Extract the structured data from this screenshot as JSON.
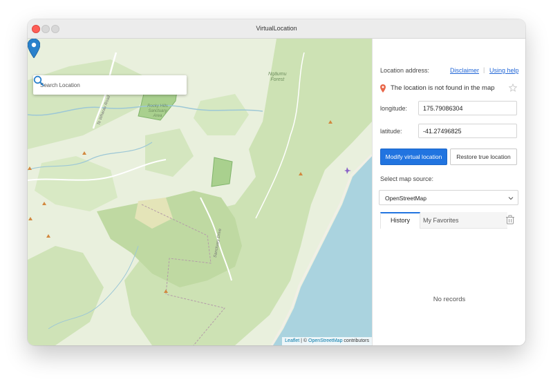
{
  "window": {
    "title": "VirtualLocation"
  },
  "map": {
    "search": {
      "placeholder": "Search Location",
      "value": ""
    },
    "labels": {
      "forest_line1": "Ngāumu",
      "forest_line2": "Forest",
      "sanctuary_line1": "Rocky Hills",
      "sanctuary_line2": "Sanctuary",
      "sanctuary_line3": "Area",
      "road": "Te Wharau Road",
      "drive": "Sanctuary Drive"
    },
    "attribution": {
      "leaflet": "Leaflet",
      "separator": "|",
      "copyright": "©",
      "osm": "OpenStreetMap",
      "contributors": "contributors"
    },
    "colors": {
      "land": "#e8efdb",
      "forest": "#c9dfae",
      "reserve": "#b6d89a",
      "sea": "#aad3df",
      "pin": "#2a81cb"
    }
  },
  "panel": {
    "address_label": "Location address:",
    "disclaimer_link": "Disclaimer",
    "link_separator": "|",
    "help_link": "Using help",
    "location_text": "The location is not found in the map",
    "longitude_label": "longitude:",
    "longitude_value": "175.79086304",
    "latitude_label": "latitude:",
    "latitude_value": "-41.27496825",
    "modify_button": "Modify virtual location",
    "restore_button": "Restore true location",
    "map_source_label": "Select map source:",
    "map_source_value": "OpenStreetMap",
    "tabs": {
      "history": "History",
      "favorites": "My Favorites"
    },
    "empty_text": "No records"
  },
  "colors": {
    "accent": "#2174e0",
    "link": "#1e64d6",
    "location_icon": "#e8674a"
  }
}
